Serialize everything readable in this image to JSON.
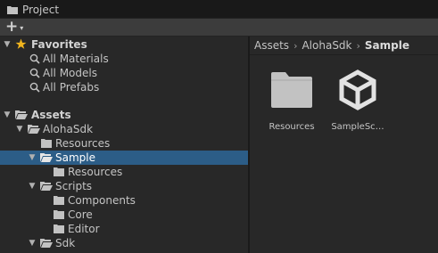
{
  "window": {
    "tab_title": "Project"
  },
  "toolbar": {
    "add_symbol": "+",
    "add_caret": "▾"
  },
  "favorites": {
    "label": "Favorites",
    "items": [
      {
        "label": "All Materials"
      },
      {
        "label": "All Models"
      },
      {
        "label": "All Prefabs"
      }
    ]
  },
  "tree": {
    "assets_label": "Assets",
    "alohasdk_label": "AlohaSdk",
    "resources_label": "Resources",
    "sample_label": "Sample",
    "sample_resources_label": "Resources",
    "scripts_label": "Scripts",
    "components_label": "Components",
    "core_label": "Core",
    "editor_label": "Editor",
    "sdk_label": "Sdk"
  },
  "breadcrumb": {
    "items": [
      "Assets",
      "AlohaSdk",
      "Sample"
    ],
    "separator": "›"
  },
  "grid": {
    "items": [
      {
        "label": "Resources",
        "icon": "folder-icon"
      },
      {
        "label": "SampleSc…",
        "icon": "unity-scene-icon"
      }
    ]
  },
  "colors": {
    "selection": "#2c5d87",
    "folder": "#c2c2c2",
    "star": "#f0b41e"
  }
}
